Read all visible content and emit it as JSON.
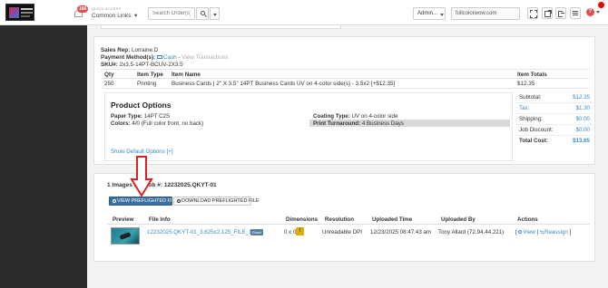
{
  "header": {
    "notification_count": "166",
    "quick_access_label": "QUICK ACCESS",
    "common_links_label": "Common Links:",
    "search_placeholder": "Search Order(s)",
    "admin_label": "Admin...",
    "domain_value": "fullcolorwow.com",
    "help_glyph": "?"
  },
  "order": {
    "sales_rep_label": "Sales Rep:",
    "sales_rep": "Lorraine.D",
    "payment_label": "Payment Method(s):",
    "payment_method": "Cash",
    "payment_separator": "-",
    "view_transactions": "View Transactions",
    "sku_label": "SKU#:",
    "sku": "2x3.5-14PT-BCUV-2X3.5"
  },
  "items_table": {
    "headers": [
      "Qty",
      "Item Type",
      "Item Name",
      "Item Totals"
    ],
    "rows": [
      {
        "qty": "250",
        "type": "Printing",
        "name": "Business Cards | 2\" X 3.5\" 14PT Business Cards UV on 4-color side(s) - 3.5x2 [+$12.35]",
        "total": "$12.35"
      }
    ]
  },
  "options": {
    "title": "Product Options",
    "paper_label": "Paper Type:",
    "paper_value": "14PT C2S",
    "colors_label": "Colors:",
    "colors_value": "4/0 (Full color front, no back)",
    "coating_label": "Coating Type:",
    "coating_value": "UV on 4-color side",
    "turnaround_label": "Print Turnaround:",
    "turnaround_value": "4 Business Days",
    "show_default": "Show Default Options [+]"
  },
  "totals": [
    {
      "label": "Subtotal:",
      "value": "$12.35"
    },
    {
      "label": "Tax:",
      "value": "$1.30"
    },
    {
      "label": "Shipping:",
      "value": "$0.00"
    },
    {
      "label": "Job Discount:",
      "value": "$0.00"
    },
    {
      "label": "Total Cost:",
      "value": "$13.65"
    }
  ],
  "images": {
    "title": "1 Images For Job #: 12232025.QKYT-01",
    "view_btn": "VIEW PREFLIGHTED FILE",
    "download_btn": "DOWNLOAD PREFLIGHTED FILE",
    "headers": [
      "Preview",
      "File Info",
      "Dimensions",
      "Resolution",
      "Uploaded Time",
      "Uploaded By",
      "Actions"
    ],
    "row": {
      "file_name": "12232025.QKYT-01_3.625x2.125_FILE_1.jpg",
      "badge": "Fixed",
      "dimensions": "0 x 0",
      "warn_glyph": "!",
      "resolution": "Unreadable DPI",
      "uploaded_time": "12/23/2025 08:47:43 am",
      "uploaded_by": "Tony Allard (72.94.44.221)",
      "action_open": "[",
      "action_view": "View",
      "action_sep": "|",
      "action_reassign": "Reassign",
      "action_close": "]"
    }
  },
  "colors": {
    "link": "#3a8ac5",
    "primary_button": "#3a6fa0",
    "annotation_arrow": "#e02020",
    "badge": "#d9534f",
    "sidebar": "#2b2b2b"
  }
}
